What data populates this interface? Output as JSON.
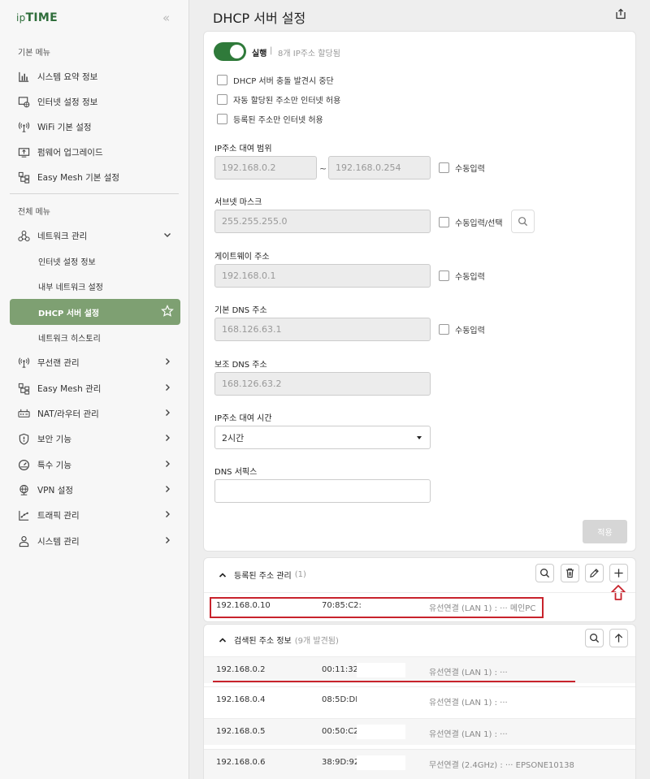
{
  "app": {
    "logo_prefix": "ip",
    "logo_main": "TIME",
    "page_title": "DHCP 서버 설정"
  },
  "sidebar": {
    "basic_title": "기본 메뉴",
    "basic_items": [
      {
        "label": "시스템 요약 정보",
        "icon": "bar-chart-icon"
      },
      {
        "label": "인터넷 설정 정보",
        "icon": "globe-monitor-icon"
      },
      {
        "label": "WiFi 기본 설정",
        "icon": "wifi-tower-icon"
      },
      {
        "label": "펌웨어 업그레이드",
        "icon": "firmware-icon"
      },
      {
        "label": "Easy Mesh 기본 설정",
        "icon": "mesh-icon"
      }
    ],
    "all_title": "전체 메뉴",
    "network_label": "네트워크 관리",
    "network_sub": [
      "인터넷 설정 정보",
      "내부 네트워크 설정",
      "DHCP 서버 설정",
      "네트워크 히스토리"
    ],
    "all_items": [
      {
        "label": "무선랜 관리",
        "icon": "wifi-tower-icon"
      },
      {
        "label": "Easy Mesh 관리",
        "icon": "mesh-icon"
      },
      {
        "label": "NAT/라우터 관리",
        "icon": "router-icon"
      },
      {
        "label": "보안 기능",
        "icon": "shield-icon"
      },
      {
        "label": "특수 기능",
        "icon": "gauge-icon"
      },
      {
        "label": "VPN 설정",
        "icon": "vpn-globe-icon"
      },
      {
        "label": "트래픽 관리",
        "icon": "traffic-icon"
      },
      {
        "label": "시스템 관리",
        "icon": "user-system-icon"
      }
    ]
  },
  "dhcp": {
    "toggle_on": true,
    "run_label": "실행",
    "separator": "|",
    "run_status": "8개 IP주소 할당됨",
    "options": [
      "DHCP 서버 충돌 발견시 중단",
      "자동 할당된 주소만 인터넷 허용",
      "등록된 주소만 인터넷 허용"
    ],
    "range_label": "IP주소 대여 범위",
    "range_start": "192.168.0.2",
    "range_sep": "~",
    "range_end": "192.168.0.254",
    "manual": "수동입력",
    "manual_select": "수동입력/선택",
    "subnet_label": "서브넷 마스크",
    "subnet": "255.255.255.0",
    "gateway_label": "게이트웨이 주소",
    "gateway": "192.168.0.1",
    "dns1_label": "기본 DNS 주소",
    "dns1": "168.126.63.1",
    "dns2_label": "보조 DNS 주소",
    "dns2": "168.126.63.2",
    "lease_label": "IP주소 대여 시간",
    "lease": "2시간",
    "suffix_label": "DNS 서픽스",
    "suffix": "",
    "apply": "적용"
  },
  "registered": {
    "title": "등록된 주소 관리",
    "count": "(1)",
    "rows": [
      {
        "ip": "192.168.0.10",
        "mac": "70:85:C2:",
        "conn": "유선연결 (LAN 1) : ··· 메인PC"
      }
    ]
  },
  "discovered": {
    "title": "검색된 주소 정보",
    "count": "(9개 발견됨)",
    "rows": [
      {
        "ip": "192.168.0.2",
        "mac": "00:11:32:",
        "conn": "유선연결 (LAN 1) : ···"
      },
      {
        "ip": "192.168.0.4",
        "mac": "08:5D:DD:",
        "conn": "유선연결 (LAN 1) : ···"
      },
      {
        "ip": "192.168.0.5",
        "mac": "00:50:C2:",
        "conn": "유선연결 (LAN 1) : ···"
      },
      {
        "ip": "192.168.0.6",
        "mac": "38:9D:92:",
        "conn": "무선연결 (2.4GHz) : ··· EPSONE10138"
      }
    ]
  },
  "colors": {
    "accent": "#2f7a3a",
    "active_menu": "#7ea072",
    "highlight": "#c8232c"
  }
}
